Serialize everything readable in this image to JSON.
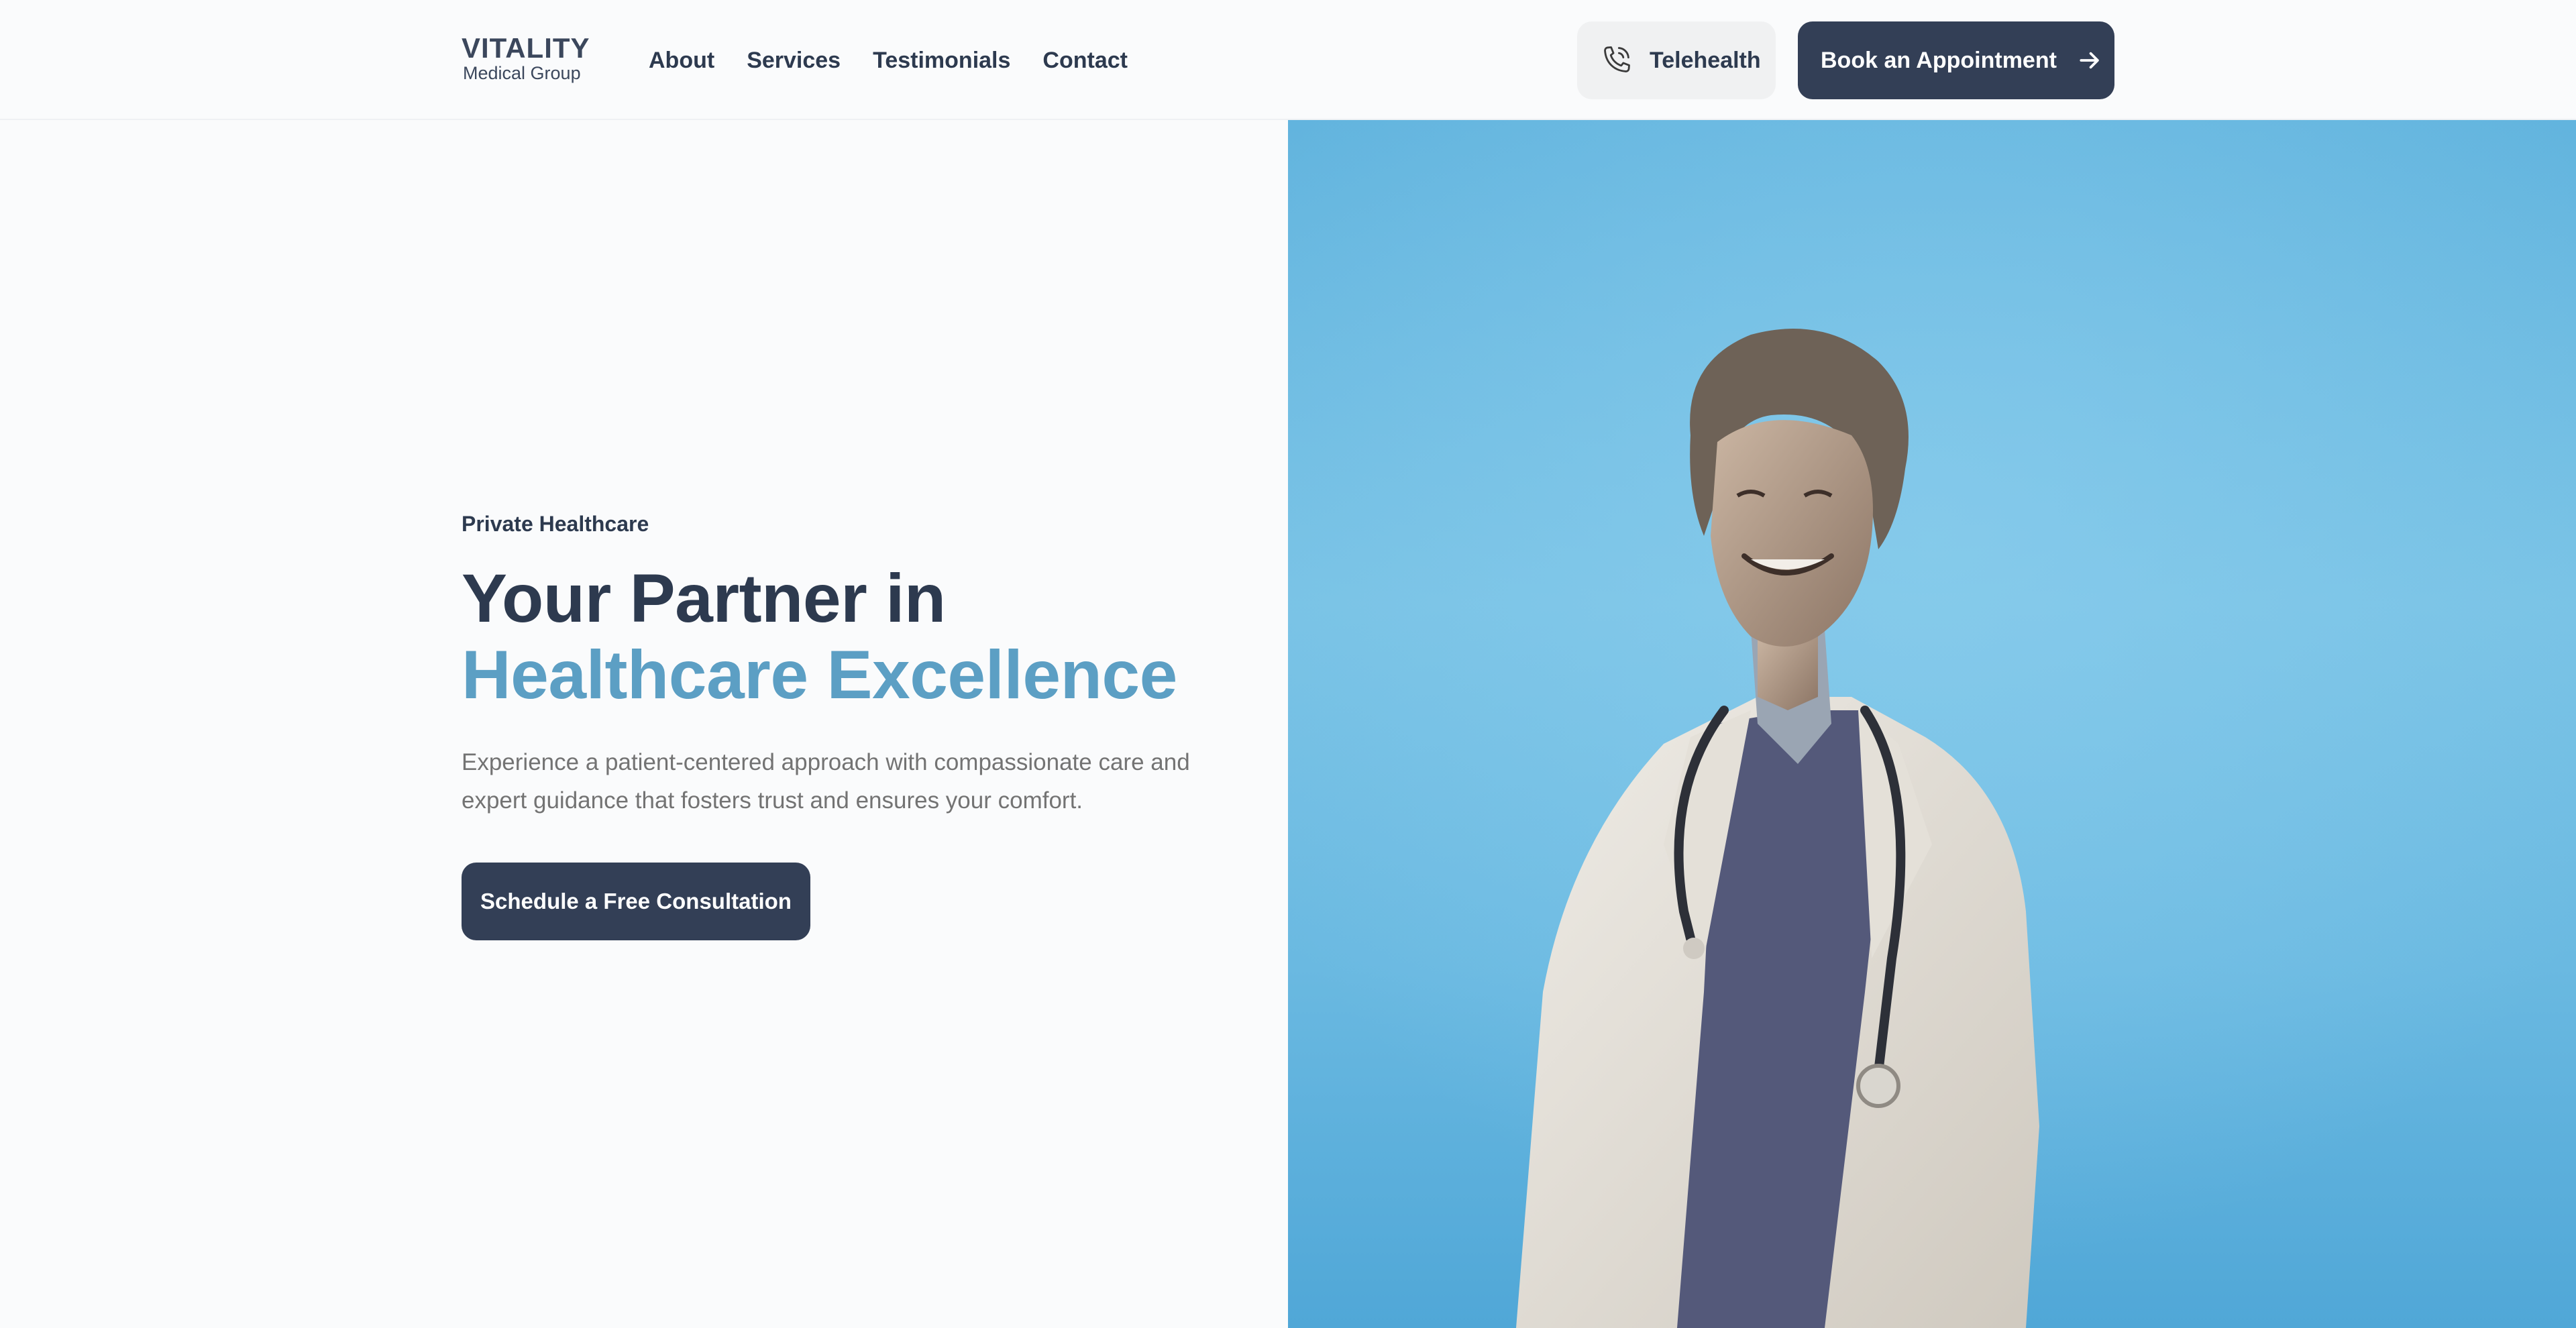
{
  "brand": {
    "name": "VITALITY",
    "subtitle": "Medical Group"
  },
  "nav": {
    "items": [
      {
        "label": "About"
      },
      {
        "label": "Services"
      },
      {
        "label": "Testimonials"
      },
      {
        "label": "Contact"
      }
    ]
  },
  "header_actions": {
    "telehealth_label": "Telehealth",
    "telehealth_icon": "phone-icon",
    "book_label": "Book an Appointment",
    "book_icon": "arrow-right-icon"
  },
  "hero": {
    "eyebrow": "Private Healthcare",
    "headline_line1": "Your Partner in",
    "headline_line2": "Healthcare Excellence",
    "description": "Experience a patient-centered approach with compassionate care and expert guidance that fosters trust and ensures your comfort.",
    "cta_label": "Schedule a Free Consultation"
  },
  "colors": {
    "primary_dark": "#333f56",
    "accent_blue": "#5c9fc4",
    "image_background": "#6ab9e1",
    "page_background": "#fafbfc"
  }
}
